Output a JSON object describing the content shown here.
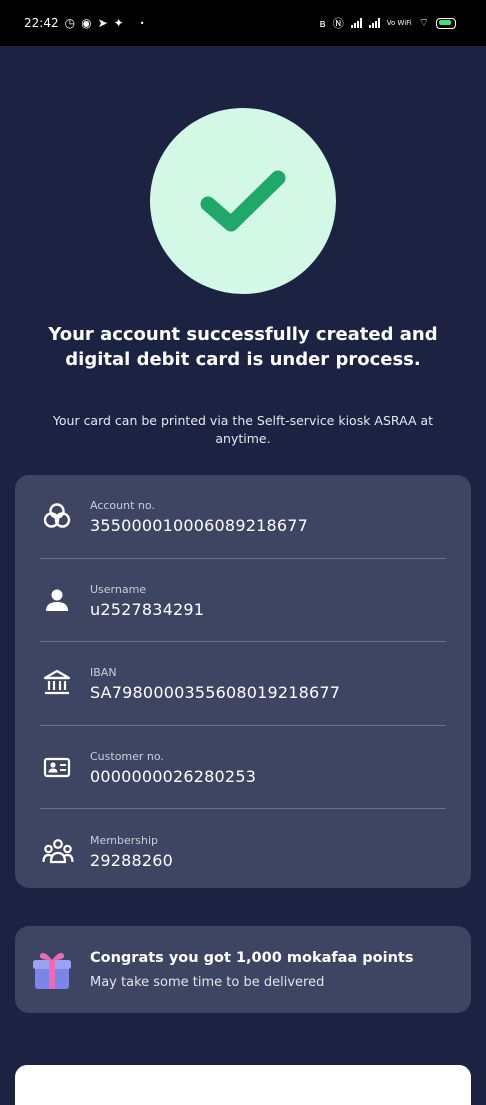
{
  "status_bar": {
    "time": "22:42",
    "left_icons": [
      "alarm-icon",
      "whatsapp-icon",
      "telegram-icon",
      "twitter-icon"
    ],
    "right_text": "Vo WiFi"
  },
  "success": {
    "headline": "Your account successfully created and digital debit card is under process.",
    "subtext": "Your card can be printed via the Selft-service kiosk ASRAA at anytime.",
    "accent_color": "#1fa86a",
    "circle_color": "#d4f8e6"
  },
  "account_details": [
    {
      "icon": "account-rings-icon",
      "label": "Account no.",
      "value": "3550000100060892186​77"
    },
    {
      "icon": "user-icon",
      "label": "Username",
      "value": "u2527834291"
    },
    {
      "icon": "bank-icon",
      "label": "IBAN",
      "value": "SA7980000355608019218677"
    },
    {
      "icon": "id-card-icon",
      "label": "Customer no.",
      "value": "0000000026280253"
    },
    {
      "icon": "group-icon",
      "label": "Membership",
      "value": "29288260"
    }
  ],
  "points": {
    "title": "Congrats you got 1,000 mokafaa points",
    "subtitle": "May take some time to be delivered",
    "icon": "gift-icon"
  },
  "colors": {
    "background": "#1c2242",
    "card": "#3e4563"
  }
}
